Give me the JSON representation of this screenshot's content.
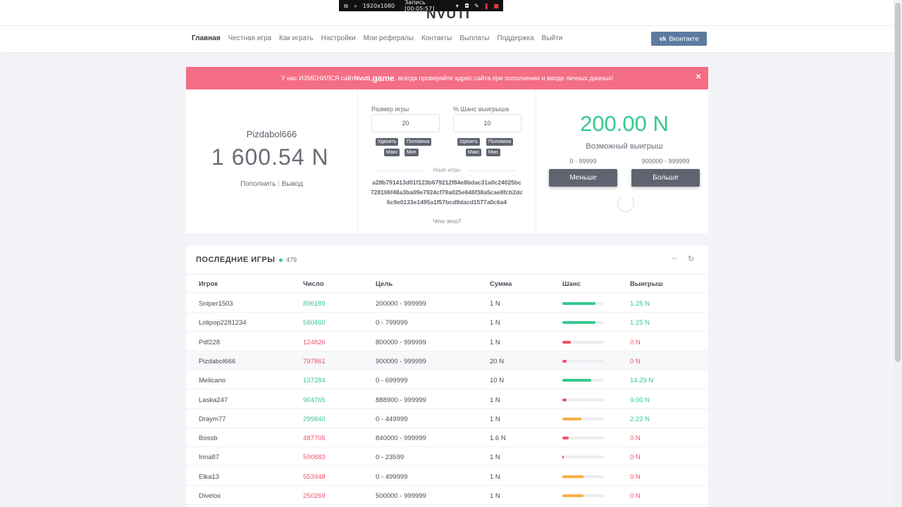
{
  "recorder": {
    "resolution": "1920x1080",
    "record_label": "Запись [00:05:57]"
  },
  "header": {
    "logo": "NVUTI",
    "nav": [
      "Главная",
      "Честная игра",
      "Как играть",
      "Настройки",
      "Мои рефералы",
      "Контакты",
      "Выплаты",
      "Поддержка",
      "Выйти"
    ],
    "vk_label": "Вконтакте",
    "vk_icon": "vk-logo"
  },
  "alert": {
    "text_before": "У нас ИЗМЕНИЛСЯ сайт ",
    "site_name": "Nvuti",
    "site_domain": ".game",
    "text_after": ", всегда проверяйте адрес сайта при пополнении и вводе личных данных!",
    "close": "×"
  },
  "user": {
    "name": "Pizdabol666",
    "balance": "1 600.54 N",
    "deposit": "Пополнить",
    "separator": "|",
    "withdraw": "Вывод"
  },
  "game": {
    "size_label": "Размер игры",
    "size_value": "20",
    "chance_label": "% Шанс выигрыша",
    "chance_value": "10",
    "double": "Удвоить",
    "half": "Половина",
    "max": "Макс",
    "min": "Мин",
    "hash_label": "Hash игры",
    "hash": "a28b791413d01f123b679212f84e8bdac31a0c24025bc728106f48a3ba09e7924cf79a025e646f38a5cae8fcb2dc6c9e0133e1495a1f57bcd9dacd1577a0c6a4",
    "what_is_it": "Что это?",
    "possible_win": "200.00 N",
    "possible_win_label": "Возможный выигрыш",
    "range_low": "0 - 99999",
    "range_high": "900000 - 999999",
    "less_btn": "Меньше",
    "more_btn": "Больше"
  },
  "games": {
    "title": "ПОСЛЕДНИЕ ИГРЫ",
    "online_count": "479",
    "minimize_icon": "minus-icon",
    "refresh_icon": "refresh-icon",
    "columns": [
      "Игрок",
      "Число",
      "Цель",
      "Сумма",
      "Шанс",
      "Выигрыш"
    ],
    "rows": [
      {
        "player": "Sniper1503",
        "number": "896189",
        "target": "200000 - 999999",
        "sum": "1 N",
        "chance_fraction": 0.8,
        "chance_color": "#36c98e",
        "win": "1.25 N",
        "won": true
      },
      {
        "player": "Lolipop2281234",
        "number": "580460",
        "target": "0 - 799999",
        "sum": "1 N",
        "chance_fraction": 0.8,
        "chance_color": "#36c98e",
        "win": "1.25 N",
        "won": true
      },
      {
        "player": "Pdf228",
        "number": "124826",
        "target": "800000 - 999999",
        "sum": "1 N",
        "chance_fraction": 0.2,
        "chance_color": "#f4516c",
        "win": "0 N",
        "won": false
      },
      {
        "player": "Pizdabol666",
        "number": "797861",
        "target": "900000 - 999999",
        "sum": "20 N",
        "chance_fraction": 0.1,
        "chance_color": "#f4516c",
        "win": "0 N",
        "won": false
      },
      {
        "player": "Melicano",
        "number": "137284",
        "target": "0 - 699999",
        "sum": "10 N",
        "chance_fraction": 0.7,
        "chance_color": "#36c98e",
        "win": "14.29 N",
        "won": true
      },
      {
        "player": "Laska247",
        "number": "904765",
        "target": "888900 - 999999",
        "sum": "1 N",
        "chance_fraction": 0.11,
        "chance_color": "#f4516c",
        "win": "9.00 N",
        "won": true
      },
      {
        "player": "Draym77",
        "number": "299840",
        "target": "0 - 449999",
        "sum": "1 N",
        "chance_fraction": 0.45,
        "chance_color": "#f6b044",
        "win": "2.22 N",
        "won": true
      },
      {
        "player": "Bossb",
        "number": "487705",
        "target": "840000 - 999999",
        "sum": "1.6 N",
        "chance_fraction": 0.16,
        "chance_color": "#f4516c",
        "win": "0 N",
        "won": false
      },
      {
        "player": "Irina87",
        "number": "500883",
        "target": "0 - 23599",
        "sum": "1 N",
        "chance_fraction": 0.024,
        "chance_color": "#f4516c",
        "win": "0 N",
        "won": false
      },
      {
        "player": "Elka13",
        "number": "553948",
        "target": "0 - 499999",
        "sum": "1 N",
        "chance_fraction": 0.5,
        "chance_color": "#f6b044",
        "win": "0 N",
        "won": false
      },
      {
        "player": "Divelox",
        "number": "250269",
        "target": "500000 - 999999",
        "sum": "1 N",
        "chance_fraction": 0.5,
        "chance_color": "#f6b044",
        "win": "0 N",
        "won": false
      }
    ]
  }
}
